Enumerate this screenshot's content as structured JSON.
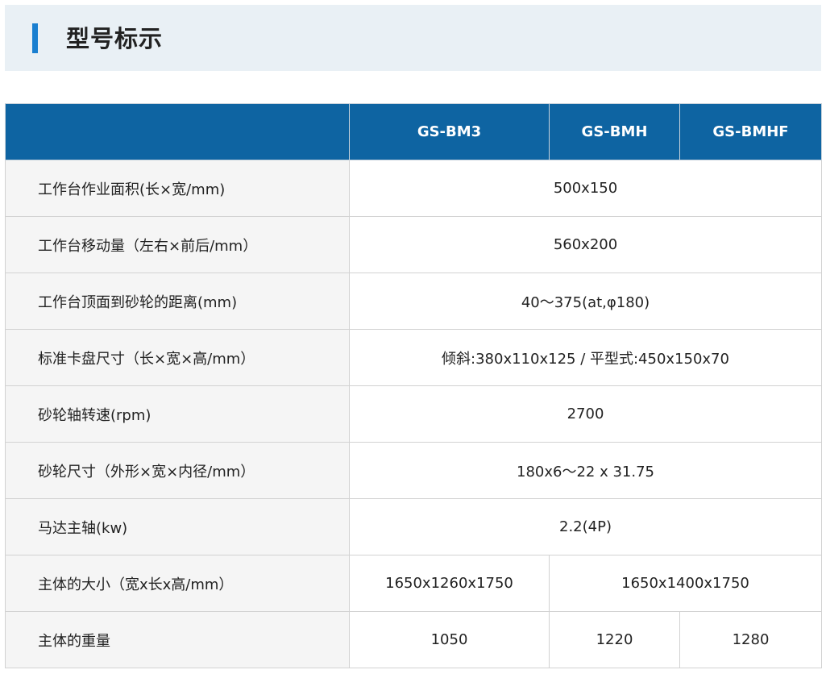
{
  "section": {
    "title": "型号标示"
  },
  "table": {
    "header": {
      "blank": "",
      "models": [
        "GS-BM3",
        "GS-BMH",
        "GS-BMHF"
      ]
    },
    "rows": [
      {
        "label": "工作台作业面积(长×宽/mm)",
        "value": "500x150"
      },
      {
        "label": "工作台移动量（左右×前后/mm）",
        "value": "560x200"
      },
      {
        "label": "工作台顶面到砂轮的距离(mm)",
        "value": "40～375(at,φ180)"
      },
      {
        "label": "标准卡盘尺寸（长×宽×高/mm）",
        "value": "倾斜:380x110x125 / 平型式:450x150x70"
      },
      {
        "label": "砂轮轴转速(rpm)",
        "value": "2700"
      },
      {
        "label": "砂轮尺寸（外形×宽×内径/mm）",
        "value": "180x6～22 x 31.75"
      },
      {
        "label": "马达主轴(kw)",
        "value": "2.2(4P)"
      },
      {
        "label": "主体的大小（宽x长x高/mm）",
        "values": [
          "1650x1260x1750",
          "1650x1400x1750"
        ]
      },
      {
        "label": "主体的重量",
        "values": [
          "1050",
          "1220",
          "1280"
        ]
      }
    ]
  },
  "colors": {
    "accent": "#1a7fd0",
    "header_bg": "#0e64a2",
    "title_bar_bg": "#e9f0f5",
    "label_bg": "#f5f5f5"
  }
}
